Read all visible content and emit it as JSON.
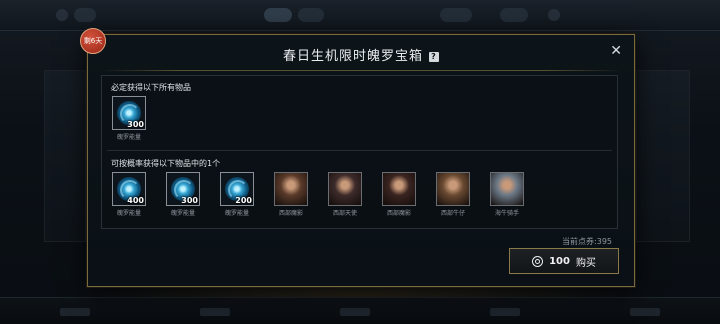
{
  "dialog": {
    "ribbon": "剩6天",
    "title": "春日生机限时魄罗宝箱",
    "help_icon": "?",
    "close_icon": "✕"
  },
  "guaranteed": {
    "label": "必定获得以下所有物品",
    "items": [
      {
        "qty": "300",
        "caption": "魄罗能量",
        "icon": "poro-energy-orb"
      }
    ]
  },
  "chance": {
    "label": "可按概率获得以下物品中的1个",
    "items": [
      {
        "qty": "400",
        "caption": "魄罗能量",
        "icon": "poro-energy-orb"
      },
      {
        "qty": "300",
        "caption": "魄罗能量",
        "icon": "poro-energy-orb"
      },
      {
        "qty": "200",
        "caption": "魄罗能量",
        "icon": "poro-energy-orb"
      },
      {
        "qty": "",
        "caption": "西部魔影",
        "icon": "champion-portrait",
        "color": "#5a3a2a"
      },
      {
        "qty": "",
        "caption": "西部天使",
        "icon": "champion-portrait",
        "color": "#3d2b2a"
      },
      {
        "qty": "",
        "caption": "西部魔影",
        "icon": "champion-portrait",
        "color": "#3a2420"
      },
      {
        "qty": "",
        "caption": "西部牛仔",
        "icon": "champion-portrait",
        "color": "#6a4a32"
      },
      {
        "qty": "",
        "caption": "海牛骑手",
        "icon": "champion-portrait",
        "color": "#6b7886"
      }
    ]
  },
  "footer": {
    "points": "当前点券:395",
    "buy_amount": "100",
    "buy_label": "购买"
  }
}
